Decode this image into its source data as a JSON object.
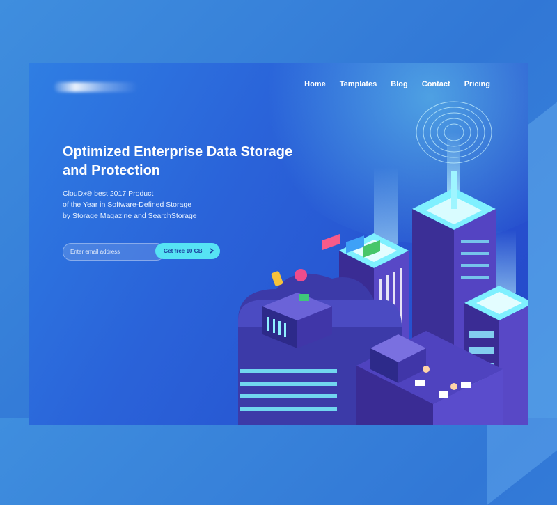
{
  "nav": {
    "items": [
      "Home",
      "Templates",
      "Blog",
      "Contact",
      "Pricing"
    ]
  },
  "hero": {
    "title": "Optimized Enterprise Data Storage and Protection",
    "description_lines": [
      "ClouDx® best 2017 Product",
      "of the Year in Software-Defined Storage",
      "by Storage Magazine and SearchStorage"
    ]
  },
  "signup": {
    "email_placeholder": "Enter email address",
    "cta_label": "Get free 10 GB",
    "cta_icon": "arrow-right-icon"
  },
  "colors": {
    "accent_cyan": "#56e3f4",
    "deep_blue": "#2446c9",
    "purple": "#5a46c8"
  }
}
